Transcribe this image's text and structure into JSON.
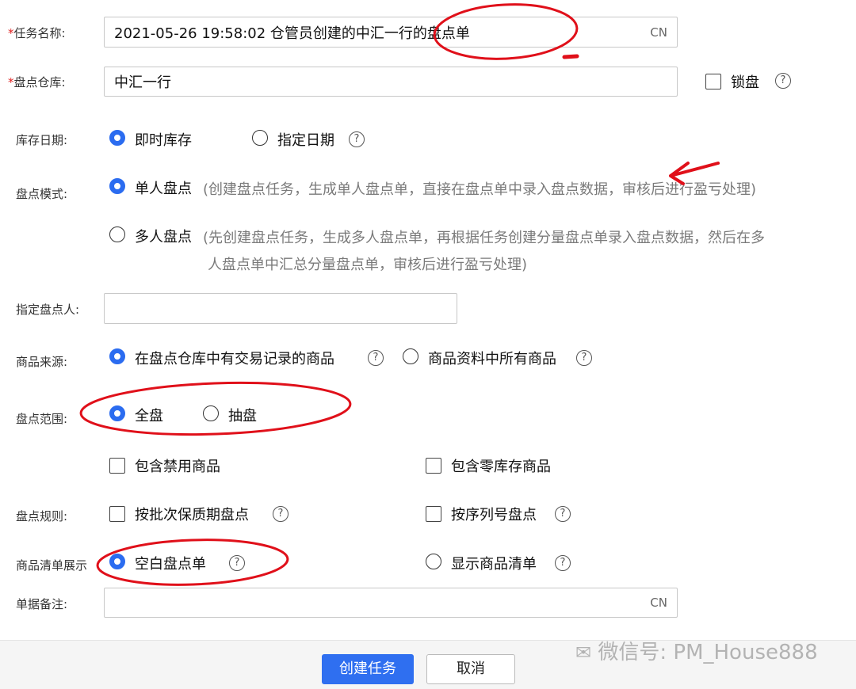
{
  "form": {
    "task_name": {
      "label": "任务名称:",
      "value": "2021-05-26 19:58:02  仓管员创建的中汇一行的盘点单",
      "suffix": "CN"
    },
    "warehouse": {
      "label": "盘点仓库:",
      "value": "中汇一行",
      "lock_label": "锁盘"
    },
    "stock_date": {
      "label": "库存日期:",
      "options": [
        "即时库存",
        "指定日期"
      ]
    },
    "mode": {
      "label": "盘点模式:",
      "single": "单人盘点",
      "single_hint": "(创建盘点任务，生成单人盘点单，直接在盘点单中录入盘点数据，审核后进行盈亏处理)",
      "multi": "多人盘点",
      "multi_hint_1": "(先创建盘点任务，生成多人盘点单，再根据任务创建分量盘点单录入盘点数据，然后在多",
      "multi_hint_2": "人盘点单中汇总分量盘点单，审核后进行盈亏处理)"
    },
    "counter": {
      "label": "指定盘点人:",
      "value": ""
    },
    "source": {
      "label": "商品来源:",
      "options": [
        "在盘点仓库中有交易记录的商品",
        "商品资料中所有商品"
      ]
    },
    "scope": {
      "label": "盘点范围:",
      "options": [
        "全盘",
        "抽盘"
      ]
    },
    "include": {
      "disabled": "包含禁用商品",
      "zero_stock": "包含零库存商品"
    },
    "rules": {
      "label": "盘点规则:",
      "batch": "按批次保质期盘点",
      "serial": "按序列号盘点"
    },
    "display": {
      "label": "商品清单展示",
      "options": [
        "空白盘点单",
        "显示商品清单"
      ]
    },
    "remark": {
      "label": "单据备注:",
      "value": "",
      "suffix": "CN"
    }
  },
  "footer": {
    "create": "创建任务",
    "cancel": "取消"
  },
  "watermark": "微信号: PM_House888",
  "colors": {
    "primary": "#2f6ff0",
    "annotation": "#e0101a",
    "required": "#e02020"
  },
  "states": {
    "warehouse_locked": false,
    "stock_date_selected": "即时库存",
    "mode_selected": "单人盘点",
    "source_selected": "在盘点仓库中有交易记录的商品",
    "scope_selected": "全盘",
    "include_disabled": false,
    "include_zero_stock": false,
    "rule_batch": false,
    "rule_serial": false,
    "display_selected": "空白盘点单"
  }
}
